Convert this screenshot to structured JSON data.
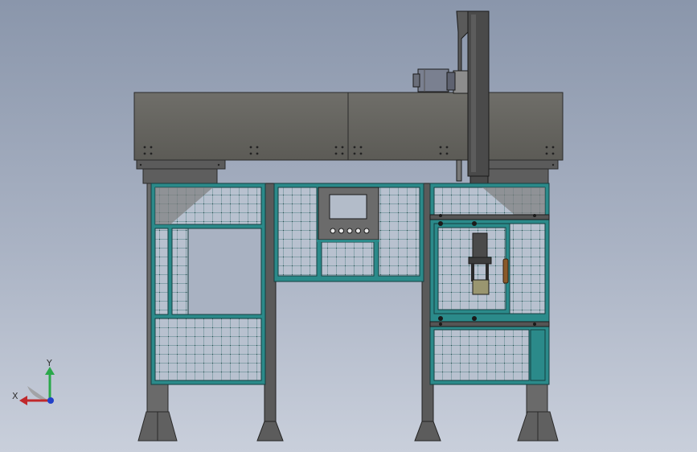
{
  "viewport": {
    "background_top": "#8a96ab",
    "background_bottom": "#c9cfdb"
  },
  "colors": {
    "frame": "#2b8a8a",
    "frame_dark": "#1d5f60",
    "steel": "#6a6a6a",
    "steel_dark": "#3c3c3c",
    "beam": "#666560",
    "mesh_bg": "#b8c1cf",
    "mesh_line": "#2d6b6b",
    "motor": "#7a8090",
    "handle": "#8a5a2a"
  },
  "triad": {
    "x_label": "X",
    "y_label": "Y",
    "x_color": "#c0282b",
    "y_color": "#2aa84a",
    "z_color": "#2240c8"
  },
  "control_panel": {
    "button_count": 5
  }
}
